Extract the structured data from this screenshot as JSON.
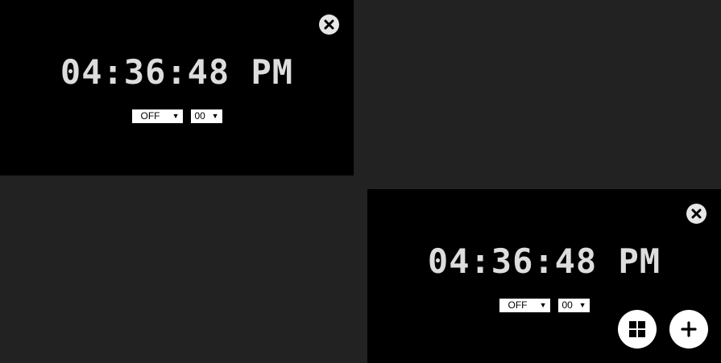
{
  "clocks": [
    {
      "time": "04:36:48 PM",
      "alarm_select": {
        "selected": "OFF",
        "arrow": "▼"
      },
      "minute_select": {
        "selected": "00",
        "arrow": "▼"
      }
    },
    {
      "time": "04:36:48 PM",
      "alarm_select": {
        "selected": "OFF",
        "arrow": "▼"
      },
      "minute_select": {
        "selected": "00",
        "arrow": "▼"
      }
    }
  ],
  "icons": {
    "close": "close-icon",
    "layout": "grid-icon",
    "add": "plus-icon"
  },
  "colors": {
    "background": "#222222",
    "panel": "#000000",
    "time_text": "#dddddd",
    "button": "#ffffff"
  }
}
